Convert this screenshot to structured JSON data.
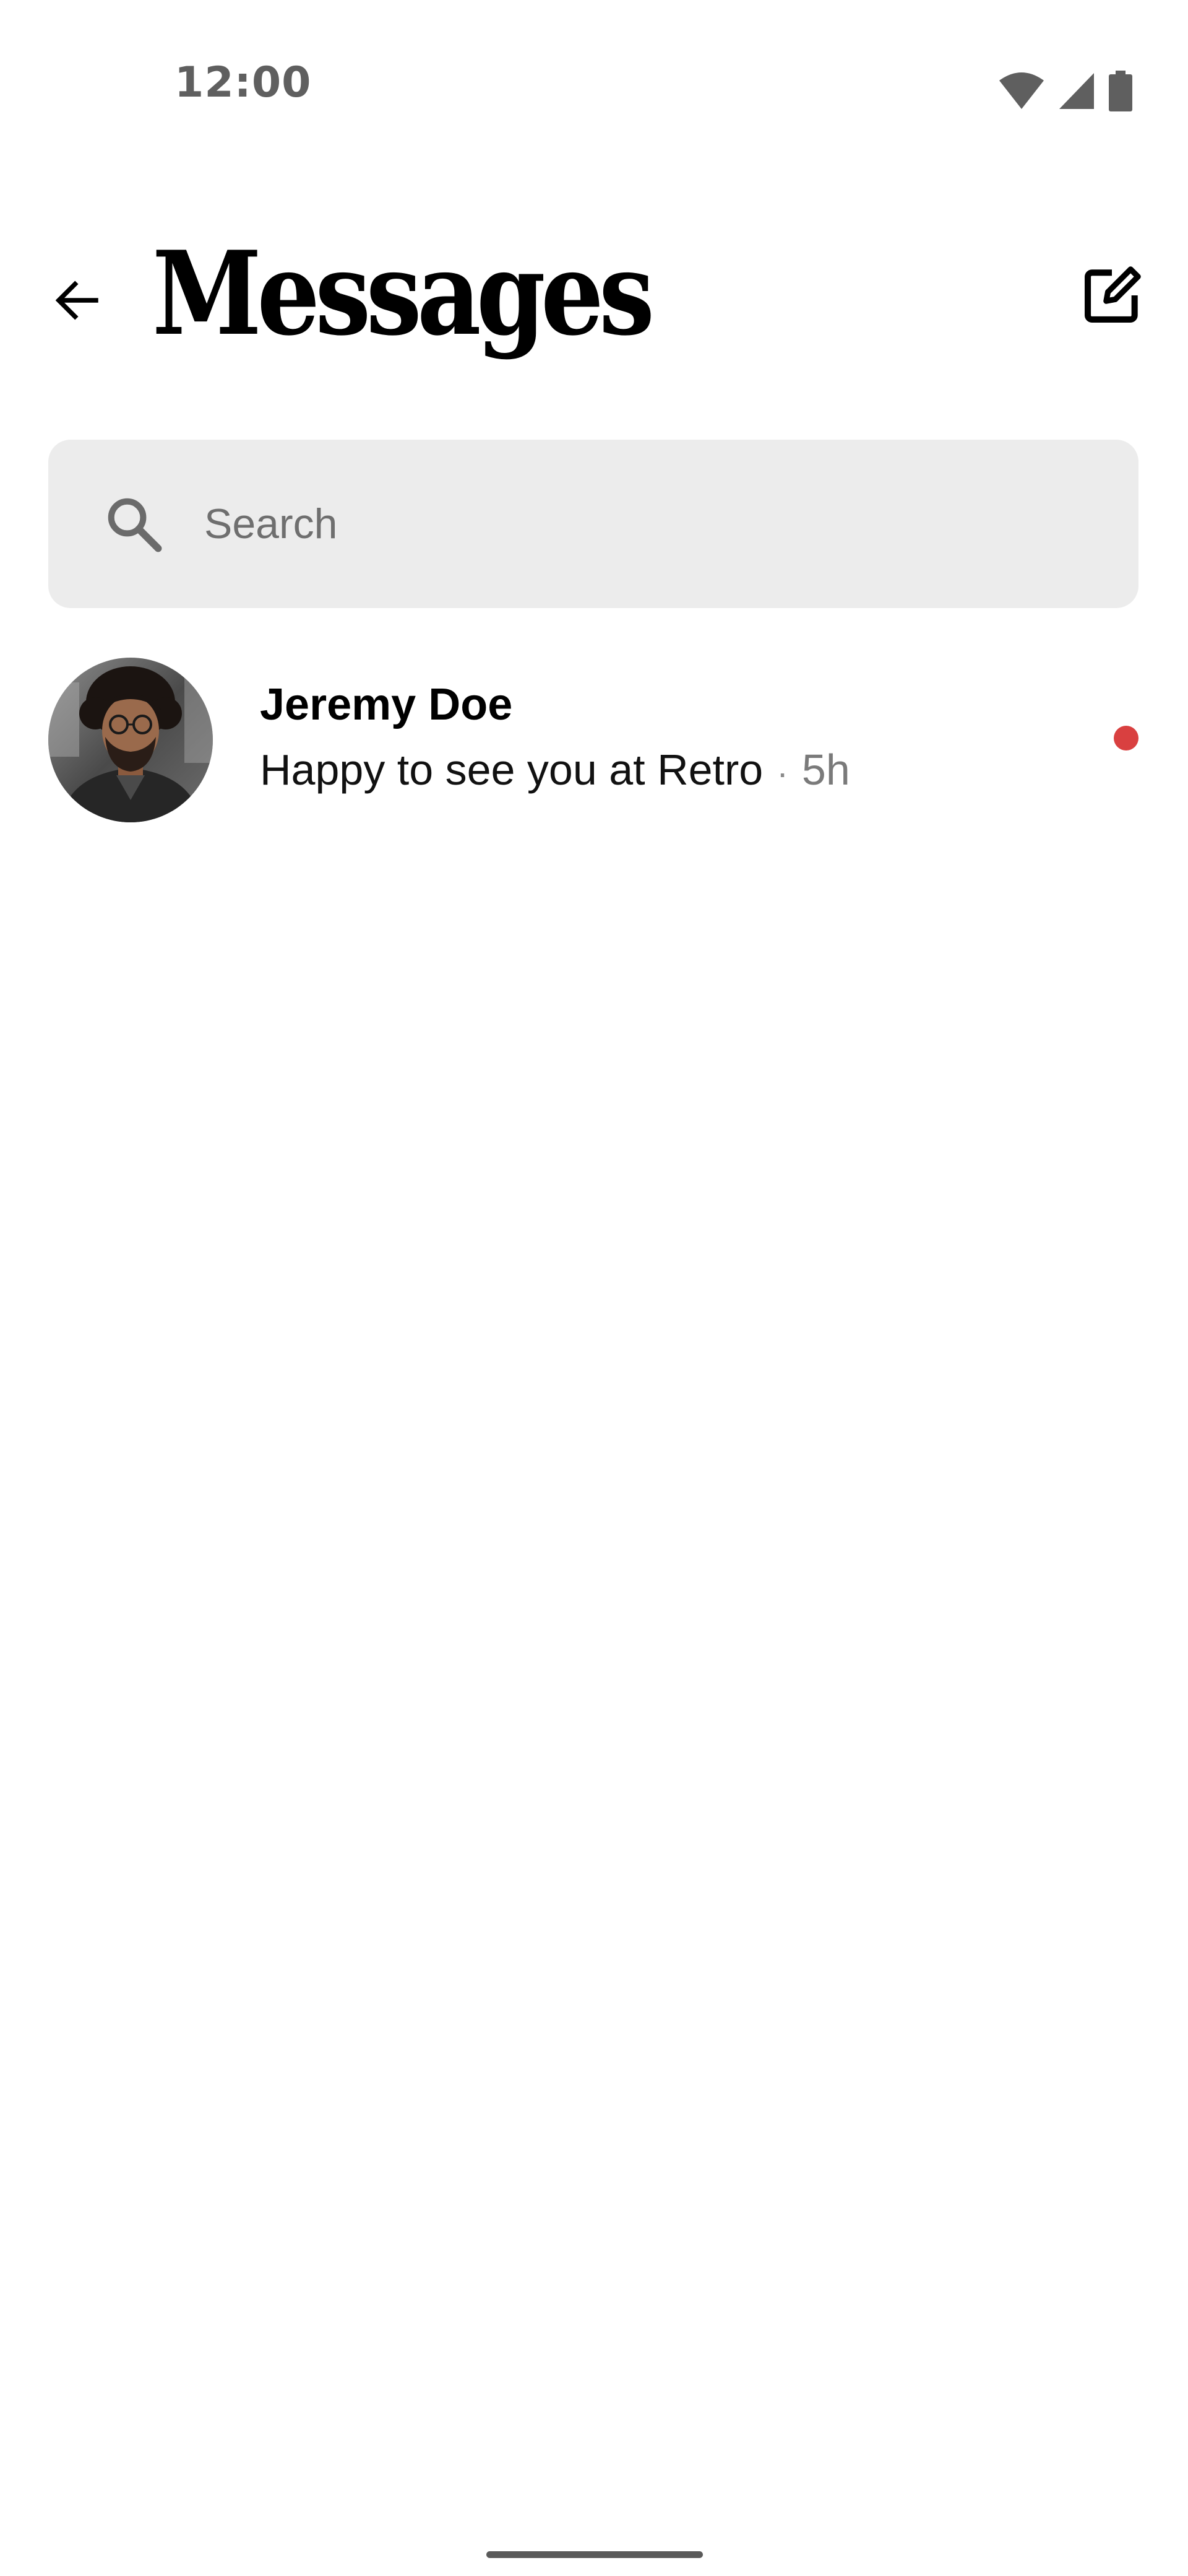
{
  "status_bar": {
    "time": "12:00",
    "icons": [
      "wifi-icon",
      "cellular-signal-icon",
      "battery-icon"
    ]
  },
  "header": {
    "title": "Messages",
    "back_icon": "arrow-left-icon",
    "compose_icon": "compose-edit-icon"
  },
  "search": {
    "placeholder": "Search",
    "value": "",
    "icon": "search-icon"
  },
  "conversations": [
    {
      "name": "Jeremy Doe",
      "preview": "Happy to see you at Retro",
      "separator": "·",
      "time": "5h",
      "unread": true
    }
  ],
  "colors": {
    "unread_dot": "#d94040",
    "search_background": "#ececec",
    "secondary_text": "#7a7a7a",
    "status_icons": "#5f5f5f"
  }
}
